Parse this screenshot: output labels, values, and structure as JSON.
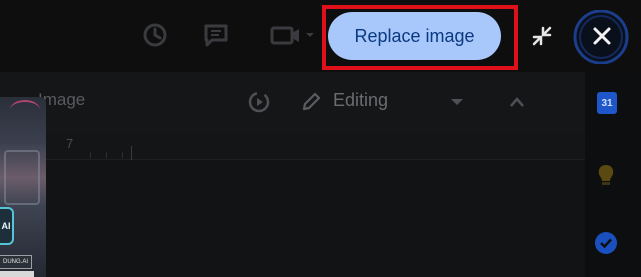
{
  "topbar": {
    "replace_button_label": "Replace image"
  },
  "toolbar": {
    "section_label": "Image",
    "mode_label": "Editing"
  },
  "ruler": {
    "number": "7"
  },
  "thumbnail": {
    "ai_badge": "AI",
    "tag_text": "DUNG.AI"
  },
  "right_rail": {
    "calendar_label": "31"
  },
  "icons": {
    "history": "history-icon",
    "comment": "comment-icon",
    "video": "video-call-icon",
    "collapse": "collapse-icon",
    "close": "close-icon",
    "avatar": "avatar-ring",
    "animate": "animate-icon",
    "pencil": "pencil-icon",
    "dropdown": "chevron-down-icon",
    "expand": "chevron-up-icon"
  },
  "colors": {
    "button_bg": "#a8c7fa",
    "button_text": "#0b3a82",
    "highlight": "#e0101a"
  }
}
